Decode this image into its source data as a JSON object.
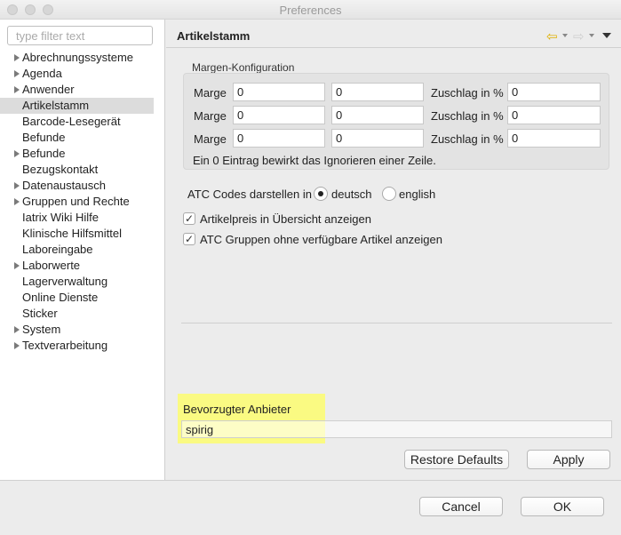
{
  "window": {
    "title": "Preferences"
  },
  "sidebar": {
    "filter_placeholder": "type filter text",
    "items": [
      {
        "label": "Abrechnungssysteme",
        "expandable": true
      },
      {
        "label": "Agenda",
        "expandable": true
      },
      {
        "label": "Anwender",
        "expandable": true
      },
      {
        "label": "Artikelstamm",
        "expandable": false,
        "selected": true
      },
      {
        "label": "Barcode-Lesegerät",
        "expandable": false
      },
      {
        "label": "Befunde",
        "expandable": false
      },
      {
        "label": "Befunde",
        "expandable": true
      },
      {
        "label": "Bezugskontakt",
        "expandable": false
      },
      {
        "label": "Datenaustausch",
        "expandable": true
      },
      {
        "label": "Gruppen und Rechte",
        "expandable": true
      },
      {
        "label": "Iatrix Wiki Hilfe",
        "expandable": false
      },
      {
        "label": "Klinische Hilfsmittel",
        "expandable": false
      },
      {
        "label": "Laboreingabe",
        "expandable": false
      },
      {
        "label": "Laborwerte",
        "expandable": true
      },
      {
        "label": "Lagerverwaltung",
        "expandable": false
      },
      {
        "label": "Online Dienste",
        "expandable": false
      },
      {
        "label": "Sticker",
        "expandable": false
      },
      {
        "label": "System",
        "expandable": true
      },
      {
        "label": "Textverarbeitung",
        "expandable": true
      }
    ]
  },
  "page": {
    "title": "Artikelstamm",
    "margin_group": {
      "label": "Margen-Konfiguration",
      "rows": [
        {
          "label": "Marge",
          "from": "0",
          "to": "0",
          "surcharge_label": "Zuschlag in %",
          "surcharge": "0"
        },
        {
          "label": "Marge",
          "from": "0",
          "to": "0",
          "surcharge_label": "Zuschlag in %",
          "surcharge": "0"
        },
        {
          "label": "Marge",
          "from": "0",
          "to": "0",
          "surcharge_label": "Zuschlag in %",
          "surcharge": "0"
        }
      ],
      "note": "Ein 0 Eintrag bewirkt das Ignorieren einer Zeile."
    },
    "atc": {
      "label": "ATC Codes darstellen in",
      "options": [
        "deutsch",
        "english"
      ],
      "selected": "deutsch"
    },
    "checkboxes": [
      {
        "label": "Artikelpreis in Übersicht anzeigen",
        "checked": true
      },
      {
        "label": "ATC Gruppen ohne verfügbare Artikel anzeigen",
        "checked": true
      }
    ],
    "preferred_vendor": {
      "label": "Bevorzugter Anbieter",
      "value": "spirig"
    },
    "restore_defaults_label": "Restore Defaults",
    "apply_label": "Apply"
  },
  "footer": {
    "cancel_label": "Cancel",
    "ok_label": "OK"
  },
  "colors": {
    "highlight": "#fafa82",
    "nav_arrow": "#e0b000"
  }
}
